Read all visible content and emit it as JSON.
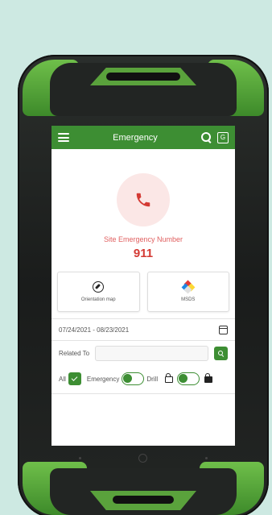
{
  "appbar": {
    "title": "Emergency",
    "translate_glyph": "G"
  },
  "call": {
    "site_label": "Site Emergency Number",
    "number": "911"
  },
  "cards": [
    {
      "label": "Orientation map",
      "icon": "compass-icon"
    },
    {
      "label": "MSDS",
      "icon": "hazard-diamond-icon"
    }
  ],
  "date_range": "07/24/2021 - 08/23/2021",
  "related": {
    "label": "Related To",
    "placeholder": ""
  },
  "filters": {
    "all_label": "All",
    "all_checked": true,
    "emergency_label": "Emergency",
    "emergency_drill_toggle_on": false,
    "drill_label": "Drill",
    "lock_toggle_on": false
  },
  "colors": {
    "primary": "#3d8e33",
    "danger": "#d43a34",
    "device_bumper": "#5aa23c",
    "background": "#cde9e2"
  }
}
